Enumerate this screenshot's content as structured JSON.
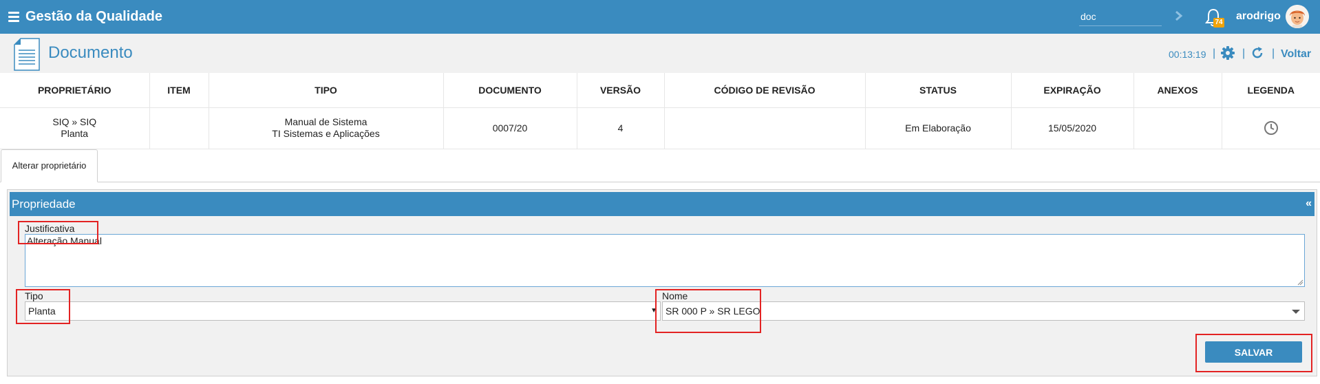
{
  "app": {
    "title": "Gestão da Qualidade"
  },
  "topbar": {
    "search_value": "doc",
    "notifications_count": "74",
    "username": "arodrigo"
  },
  "page": {
    "title": "Documento",
    "timer": "00:13:19",
    "back_label": "Voltar"
  },
  "table": {
    "headers": [
      "PROPRIETÁRIO",
      "ITEM",
      "TIPO",
      "DOCUMENTO",
      "VERSÃO",
      "CÓDIGO DE REVISÃO",
      "STATUS",
      "EXPIRAÇÃO",
      "ANEXOS",
      "LEGENDA"
    ],
    "row": {
      "proprietario_line1": "SIQ » SIQ",
      "proprietario_line2": "Planta",
      "item": "",
      "tipo_line1": "Manual de Sistema",
      "tipo_line2": "TI Sistemas e Aplicações",
      "documento": "0007/20",
      "versao": "4",
      "codigo_revisao": "",
      "status": "Em Elaboração",
      "expiracao": "15/05/2020",
      "anexos": ""
    },
    "legend_icon": "clock-icon"
  },
  "tabs": [
    {
      "label": "Alterar proprietário"
    }
  ],
  "panel": {
    "title": "Propriedade",
    "collapse_label": "«",
    "justificativa_label": "Justificativa",
    "justificativa_value": "Alteração Manual",
    "tipo_label": "Tipo",
    "tipo_value": "Planta",
    "nome_label": "Nome",
    "nome_value": "SR 000 P » SR LEGO",
    "save_label": "SALVAR"
  },
  "colors": {
    "primary": "#3a8bbf",
    "badge": "#f0a30a",
    "highlight": "#e32222",
    "background": "#f1f1f1"
  }
}
